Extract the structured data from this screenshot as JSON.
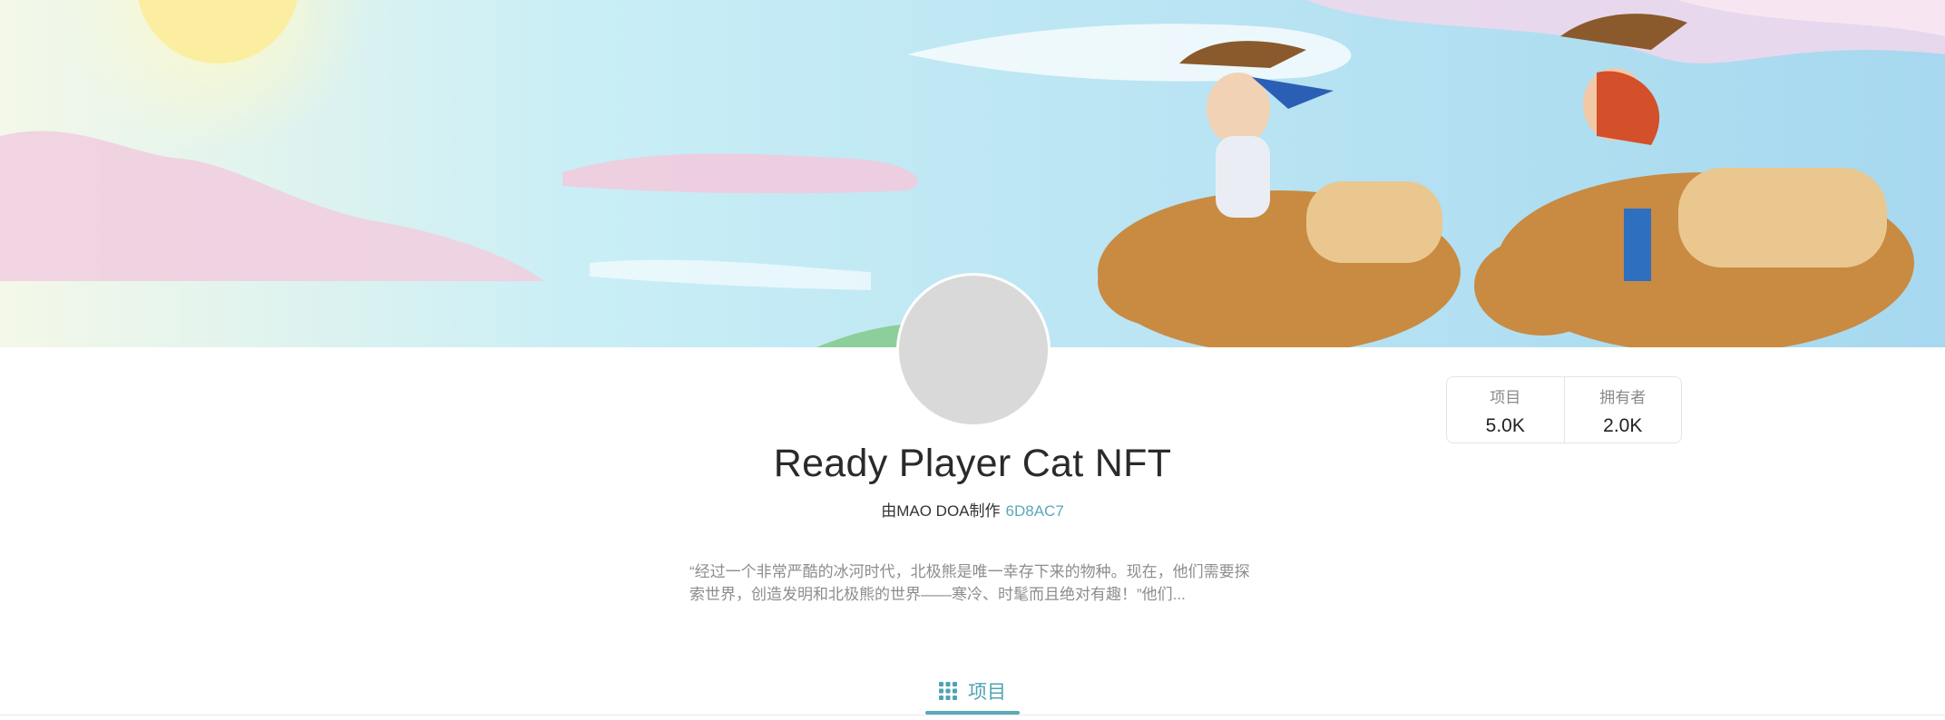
{
  "collection": {
    "name": "Ready Player Cat NFT",
    "creator_prefix": "由MAO DOA制作",
    "creator_address": "6D8AC7",
    "description": "“经过一个非常严酷的冰河时代，北极熊是唯一幸存下来的物种。现在，他们需要探索世界，创造发明和北极熊的世界——寒冷、时髦而且绝对有趣！”他们..."
  },
  "stats": [
    {
      "label": "项目",
      "value": "5.0K"
    },
    {
      "label": "拥有者",
      "value": "2.0K"
    }
  ],
  "tabs": [
    {
      "label": "项目",
      "icon": "grid-icon",
      "active": true
    }
  ],
  "colors": {
    "accent": "#5aa7b8",
    "avatar_placeholder": "#d9d9d9",
    "border": "#e4e4e4"
  }
}
